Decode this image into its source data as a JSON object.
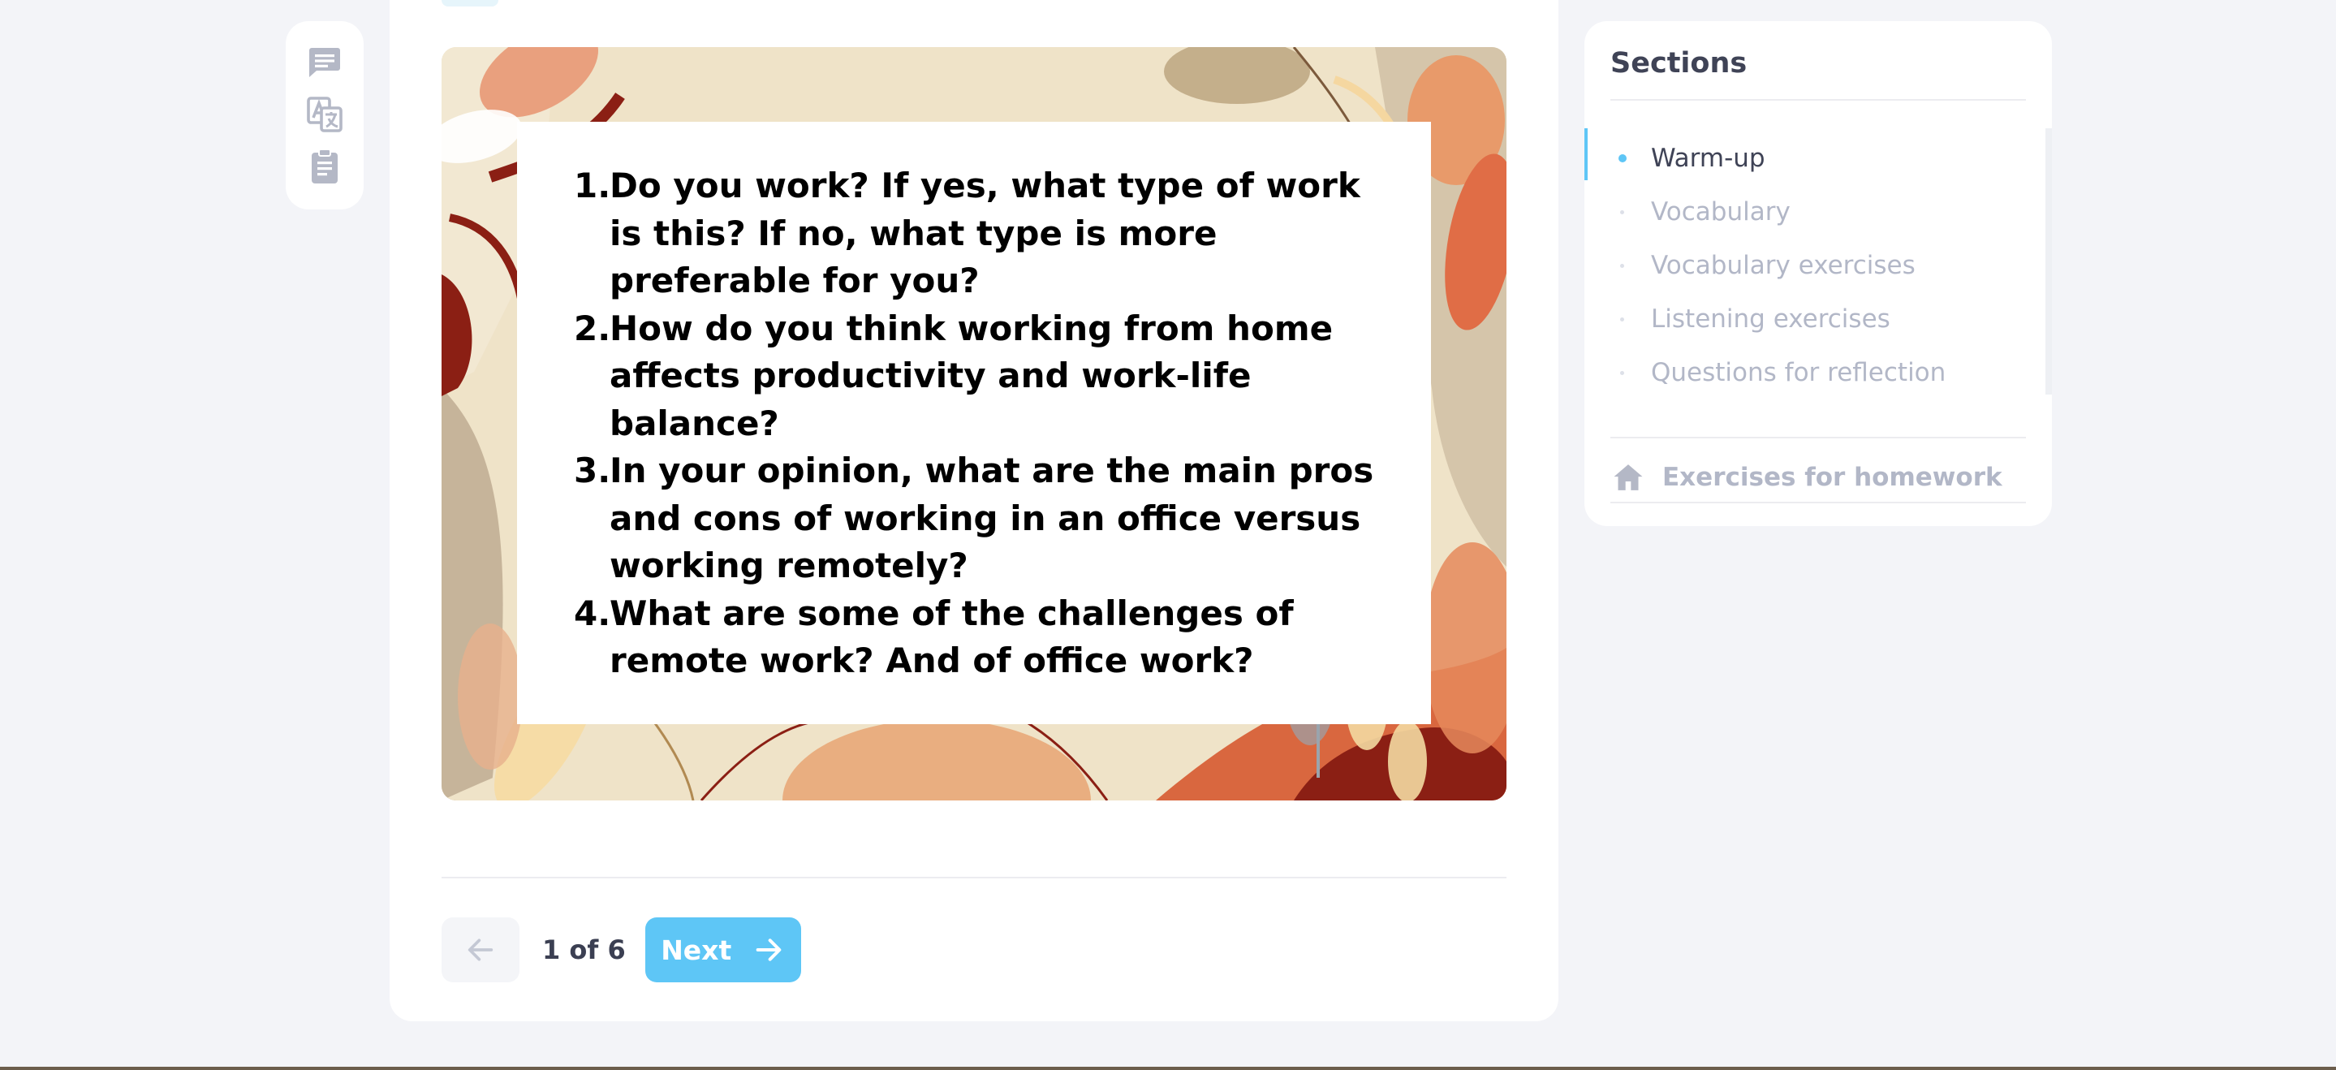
{
  "toolbar": {
    "icons": [
      "comment-icon",
      "translate-icon",
      "clipboard-icon"
    ]
  },
  "slide": {
    "questions": [
      {
        "number": "1.",
        "text": "Do you work? If yes, what type of work is this? If no, what type is more preferable for you?"
      },
      {
        "number": "2.",
        "text": "How do you think working from home affects productivity and work-life balance?"
      },
      {
        "number": "3.",
        "text": "In your opinion, what are the main pros and cons of working in an office versus working remotely?"
      },
      {
        "number": "4.",
        "text": "What are some of the challenges of remote work? And of office work?"
      }
    ]
  },
  "pagination": {
    "page_label": "1 of 6",
    "next_label": "Next"
  },
  "sections": {
    "title": "Sections",
    "items": [
      {
        "label": "Warm-up",
        "active": true
      },
      {
        "label": "Vocabulary",
        "active": false
      },
      {
        "label": "Vocabulary exercises",
        "active": false
      },
      {
        "label": "Listening exercises",
        "active": false
      },
      {
        "label": "Questions for reflection",
        "active": false
      }
    ],
    "homework_label": "Exercises for homework"
  },
  "colors": {
    "accent": "#5ec6f6",
    "muted_text": "#b2b7c7",
    "title_text": "#3f4356",
    "background": "#f3f4f8"
  }
}
